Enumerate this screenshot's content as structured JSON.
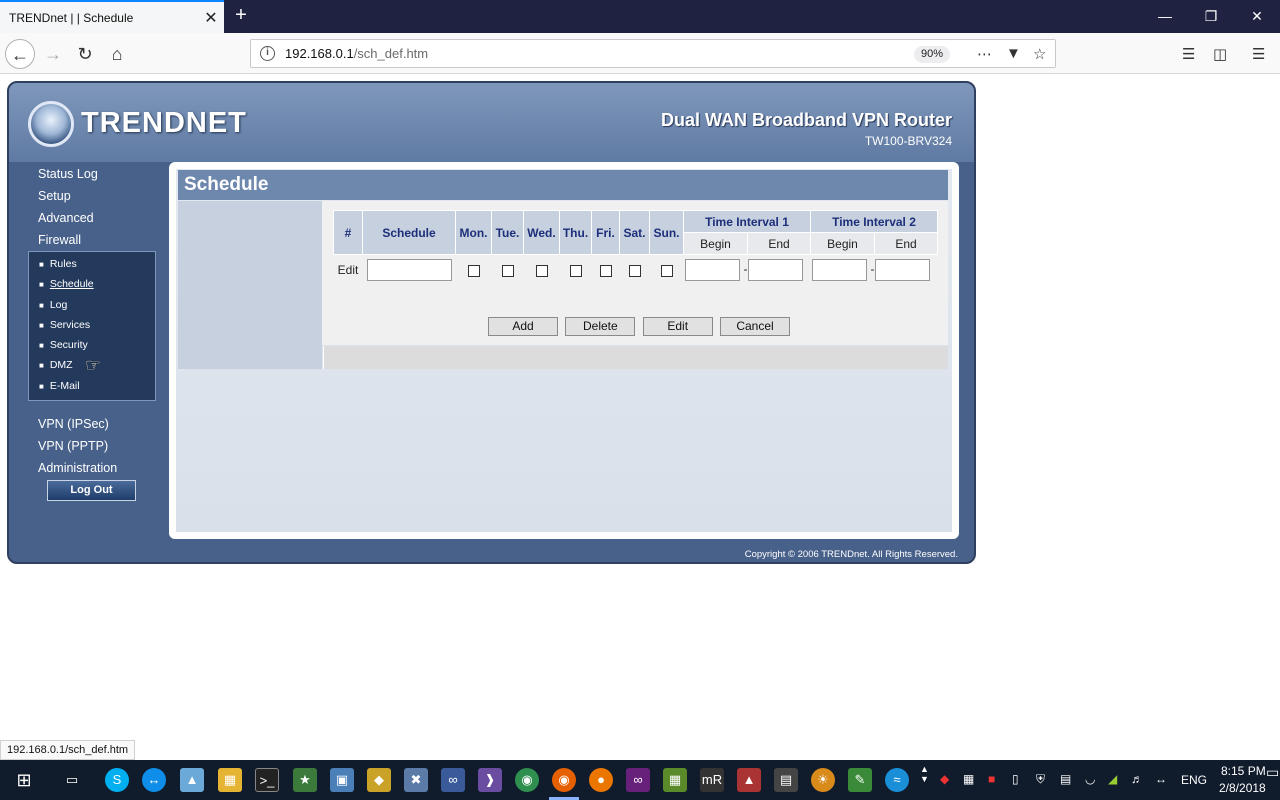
{
  "browser": {
    "tab_title": "TRENDnet | | Schedule",
    "tab_close": "✕",
    "new_tab": "+",
    "url_host": "192.168.0.1",
    "url_path": "/sch_def.htm",
    "zoom": "90%",
    "status_url": "192.168.0.1/sch_def.htm"
  },
  "router": {
    "logo": "TRENDNET",
    "product_name": "Dual WAN Broadband VPN Router",
    "model": "TW100-BRV324",
    "copyright": "Copyright © 2006 TRENDnet. All Rights Reserved.",
    "logout": "Log Out"
  },
  "nav": {
    "top": [
      "Status Log",
      "Setup",
      "Advanced",
      "Firewall"
    ],
    "firewall_sub": [
      "Rules",
      "Schedule",
      "Log",
      "Services",
      "Security",
      "DMZ",
      "E-Mail"
    ],
    "bottom": [
      "VPN (IPSec)",
      "VPN (PPTP)",
      "Administration"
    ]
  },
  "page": {
    "title": "Schedule",
    "columns": [
      "#",
      "Schedule",
      "Mon.",
      "Tue.",
      "Wed.",
      "Thu.",
      "Fri.",
      "Sat.",
      "Sun."
    ],
    "interval1": "Time Interval 1",
    "interval2": "Time Interval 2",
    "begin": "Begin",
    "end": "End",
    "row_label": "Edit",
    "dash": "-",
    "buttons": {
      "add": "Add",
      "delete": "Delete",
      "edit": "Edit",
      "cancel": "Cancel"
    }
  },
  "taskbar": {
    "lang": "ENG",
    "time": "8:15 PM",
    "date": "2/8/2018"
  }
}
